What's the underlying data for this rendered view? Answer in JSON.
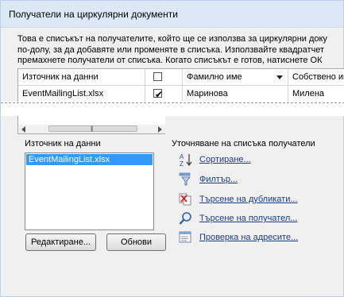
{
  "window": {
    "title": "Получатели на циркулярни документи"
  },
  "description": {
    "lines": [
      "Това е списъкът на получателите, който ще се използва за циркулярни доку",
      "по-долу, за да добавяте или променяте в списъка. Използвайте квадратчет",
      "премахнете получатели от списъка. Когато списъкът е готов, натиснете ОК"
    ]
  },
  "grid": {
    "headers": {
      "source": "Източник на данни",
      "last_name": "Фамилно име",
      "first_name": "Собствено име"
    },
    "rows": [
      {
        "source": "EventMailingList.xlsx",
        "checked": true,
        "last_name": "Маринова",
        "first_name": "Милена"
      }
    ]
  },
  "data_source": {
    "label": "Източник на данни",
    "items": [
      "EventMailingList.xlsx"
    ],
    "edit_button": "Редактиране...",
    "refresh_button": "Обнови"
  },
  "refine": {
    "label": "Уточняване на списъка получатели",
    "links": [
      {
        "label": "Сортиране...",
        "icon": "sort-az-icon"
      },
      {
        "label": "Филтър...",
        "icon": "filter-icon"
      },
      {
        "label": "Търсене на дубликати...",
        "icon": "find-duplicates-icon"
      },
      {
        "label": "Търсене на получател...",
        "icon": "find-recipient-icon"
      },
      {
        "label": "Проверка на адресите...",
        "icon": "validate-addresses-icon"
      }
    ]
  },
  "colors": {
    "link": "#1a3d8a",
    "selection": "#3399ff",
    "titlebar": "#dbe8f5"
  }
}
